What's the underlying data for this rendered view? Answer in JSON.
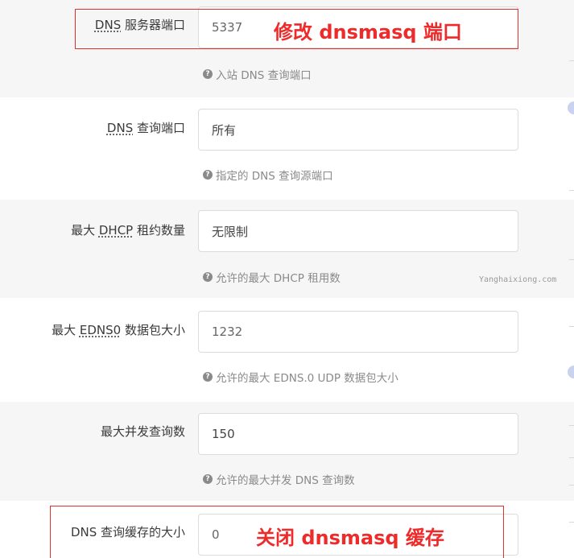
{
  "fields": [
    {
      "label_abbr": "DNS",
      "label_rest": " 服务器端口",
      "label_plain": "",
      "value": "5337",
      "hint": "入站 DNS 查询端口"
    },
    {
      "label_abbr": "DNS",
      "label_rest": " 查询端口",
      "label_plain": "",
      "value": "所有",
      "hint": "指定的 DNS 查询源端口"
    },
    {
      "label_pre": "最大 ",
      "label_abbr": "DHCP",
      "label_rest": " 租约数量",
      "value": "无限制",
      "hint": "允许的最大 DHCP 租用数"
    },
    {
      "label_pre": "最大 ",
      "label_abbr": "EDNS0",
      "label_rest": " 数据包大小",
      "value": "1232",
      "hint": "允许的最大 EDNS.0 UDP 数据包大小"
    },
    {
      "label_plain": "最大并发查询数",
      "value": "150",
      "hint": "允许的最大并发 DNS 查询数"
    },
    {
      "label_plain": "DNS 查询缓存的大小",
      "value": "0",
      "hint": ""
    }
  ],
  "annotations": {
    "port_note": "修改 dnsmasq 端口",
    "cache_note": "关闭 dnsmasq 缓存",
    "color": "#ee2b2b"
  },
  "watermark": "Yanghaixiong.com",
  "hint_icon": "question-circle-icon"
}
